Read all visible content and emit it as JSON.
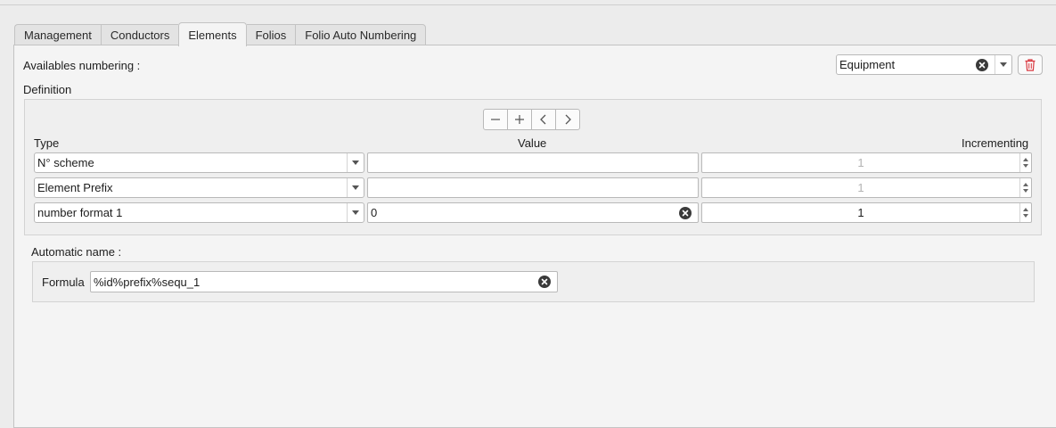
{
  "tabs": [
    {
      "label": "Management"
    },
    {
      "label": "Conductors"
    },
    {
      "label": "Elements"
    },
    {
      "label": "Folios"
    },
    {
      "label": "Folio Auto Numbering"
    }
  ],
  "active_tab": "Elements",
  "available_numbering": {
    "label": "Availables numbering :",
    "selected": "Equipment"
  },
  "definition": {
    "label": "Definition",
    "columns": {
      "type": "Type",
      "value": "Value",
      "incrementing": "Incrementing"
    },
    "rows": [
      {
        "type": "N° scheme",
        "value": "",
        "incrementing": "1",
        "incrementing_enabled": false
      },
      {
        "type": "Element Prefix",
        "value": "",
        "incrementing": "1",
        "incrementing_enabled": false
      },
      {
        "type": "number format 1",
        "value": "0",
        "incrementing": "1",
        "incrementing_enabled": true
      }
    ]
  },
  "automatic_name": {
    "label": "Automatic name :",
    "formula_label": "Formula",
    "formula_value": "%id%prefix%sequ_1"
  },
  "icons": {
    "remove": "minus-icon",
    "add": "plus-icon",
    "left": "chevron-left-icon",
    "right": "chevron-right-icon",
    "delete": "trash-icon",
    "clear": "clear-icon"
  },
  "colors": {
    "delete_icon": "#d9363e"
  }
}
